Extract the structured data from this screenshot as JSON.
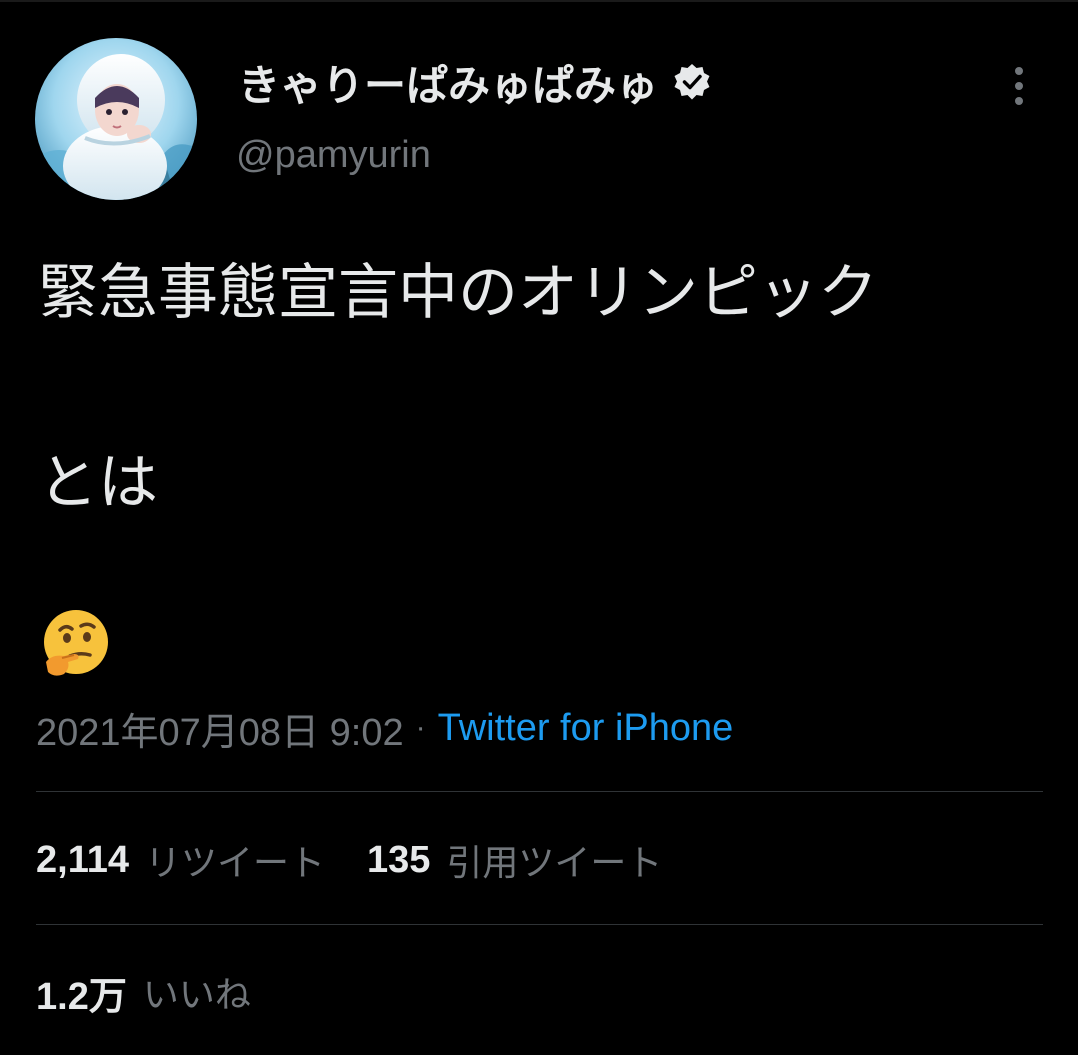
{
  "user": {
    "display_name": "きゃりーぱみゅぱみゅ",
    "handle": "@pamyurin",
    "verified": true
  },
  "tweet": {
    "lines": [
      "緊急事態宣言中のオリンピック",
      "とは"
    ],
    "emoji": "thinking-face"
  },
  "meta": {
    "timestamp": "2021年07月08日 9:02",
    "separator": "·",
    "source": "Twitter for iPhone"
  },
  "stats": {
    "retweets": {
      "count": "2,114",
      "label": "リツイート"
    },
    "quotes": {
      "count": "135",
      "label": "引用ツイート"
    },
    "likes": {
      "count": "1.2万",
      "label": "いいね"
    }
  },
  "colors": {
    "background": "#000000",
    "text": "#e7e9ea",
    "secondary": "#71767b",
    "link": "#1d9bf0",
    "divider": "#2f3336"
  }
}
